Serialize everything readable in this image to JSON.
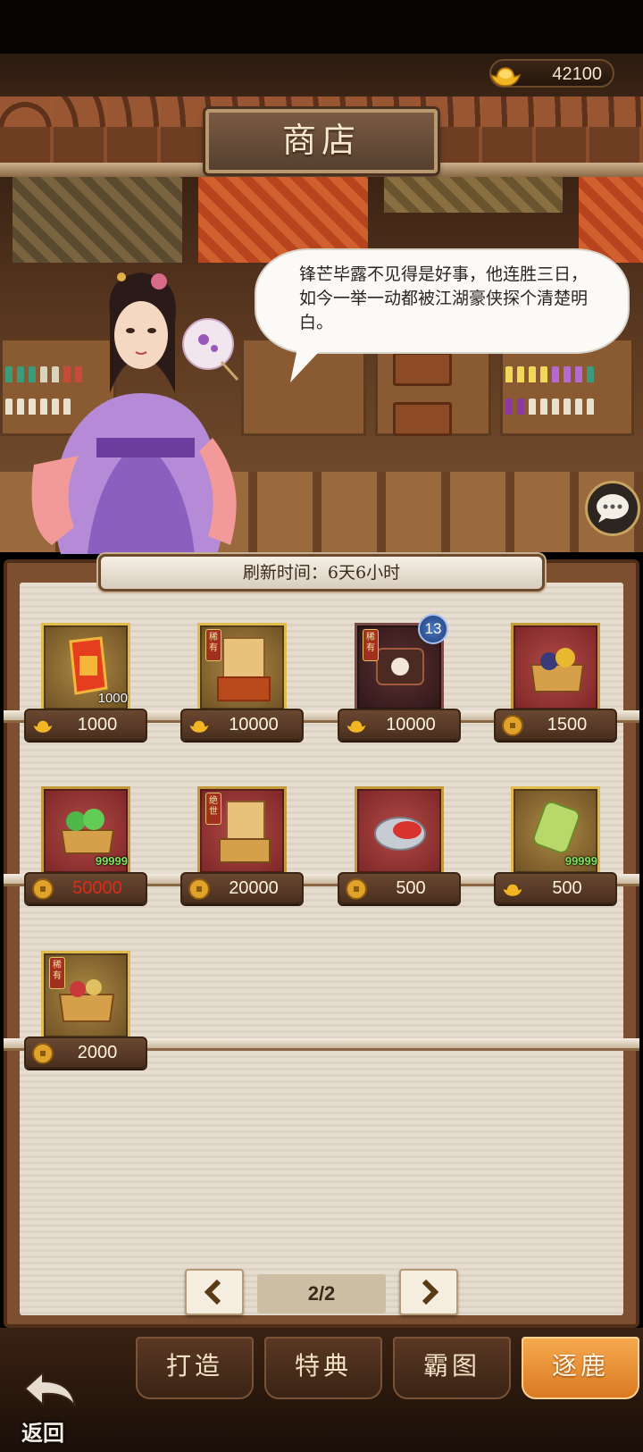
{
  "currency": {
    "gold": "42100",
    "icon": "gold-ingot-icon"
  },
  "header": {
    "title": "商店"
  },
  "npc": {
    "dialogue": "锋芒毕露不见得是好事，他连胜三日，如今一举一动都被江湖豪侠探个清楚明白。"
  },
  "shop": {
    "refresh": "刷新时间：6天6小时",
    "items": [
      {
        "name": "red-token-item",
        "count": "1000",
        "price": "1000",
        "currency": "gold-ingot-icon"
      },
      {
        "name": "rare-scroll-chest-item",
        "tag": "稀有",
        "price": "10000",
        "currency": "gold-ingot-icon"
      },
      {
        "name": "rare-sealed-scroll-item",
        "tag": "稀有",
        "badge": "13",
        "price": "10000",
        "currency": "gold-ingot-icon"
      },
      {
        "name": "ore-chest-item",
        "price": "1500",
        "currency": "coin-icon"
      },
      {
        "name": "jade-chest-item",
        "count": "99999",
        "price": "50000",
        "price_color": "#e02a1a",
        "currency": "coin-icon"
      },
      {
        "name": "legendary-scroll-chest-item",
        "tag": "绝世",
        "price": "20000",
        "currency": "coin-icon"
      },
      {
        "name": "rouge-box-item",
        "price": "500",
        "currency": "coin-icon"
      },
      {
        "name": "jade-tablet-item",
        "count": "99999",
        "price": "500",
        "currency": "gold-ingot-icon"
      },
      {
        "name": "rare-treasure-box-item",
        "tag": "稀有",
        "price": "2000",
        "currency": "coin-icon"
      }
    ]
  },
  "pager": {
    "label": "2/2",
    "prev": "chevron-left-icon",
    "next": "chevron-right-icon"
  },
  "tabs": [
    {
      "label": "打造"
    },
    {
      "label": "特典"
    },
    {
      "label": "霸图"
    },
    {
      "label": "逐鹿",
      "active": true
    }
  ],
  "back": {
    "label": "返回"
  }
}
